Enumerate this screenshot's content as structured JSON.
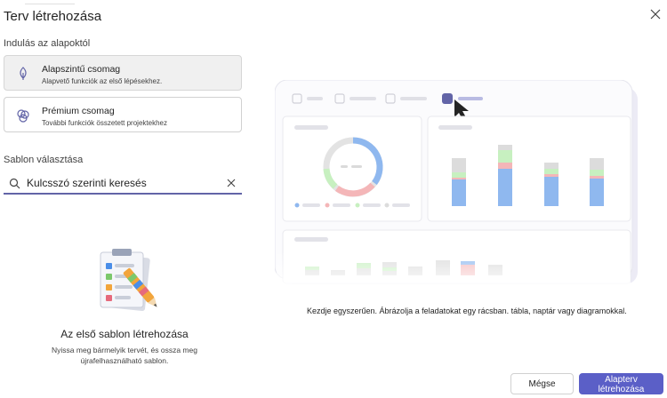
{
  "dialog": {
    "title": "Terv létrehozása",
    "close_icon": "close-icon"
  },
  "start": {
    "label": "Indulás az alapoktól",
    "packages": [
      {
        "name": "Alapszintű csomag",
        "description": "Alapvető funkciók az első lépésekhez.",
        "icon": "leaf-icon",
        "selected": true
      },
      {
        "name": "Prémium csomag",
        "description": "További funkciók összetett projektekhez",
        "icon": "premium-icon",
        "selected": false
      }
    ]
  },
  "template": {
    "label": "Sablon választása",
    "search_value": "Kulcsszó szerinti keresés"
  },
  "empty_state": {
    "title": "Az első sablon létrehozása",
    "description": "Nyissa meg bármelyik tervét, és ossza meg újrafelhasználható sablon."
  },
  "preview": {
    "caption": "Kezdje egyszerűen. Ábrázolja a feladatokat egy rácsban. tábla, naptár vagy diagramokkal.",
    "colors": {
      "blue": "#8fb8ef",
      "green": "#c7f0c0",
      "red": "#f4b6b8",
      "gray": "#dcdcdc",
      "accent": "#6264a7"
    }
  },
  "footer": {
    "cancel_label": "Mégse",
    "create_label": "Alapterv létrehozása"
  }
}
